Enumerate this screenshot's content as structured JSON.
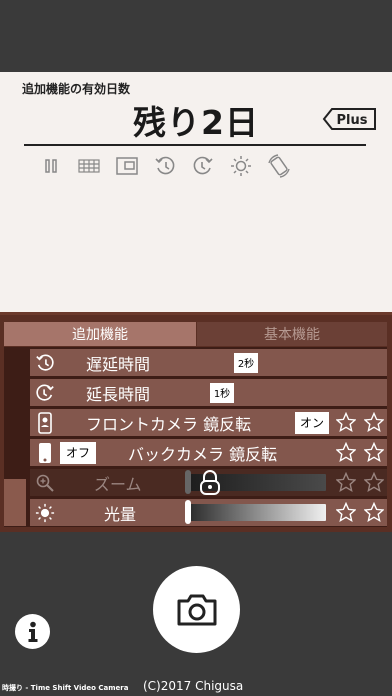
{
  "card": {
    "caption": "追加機能の有効日数",
    "days_left": "残り2日",
    "plus_badge": "Plus",
    "icons": [
      "pause-icon",
      "grid-icon",
      "picture-in-picture-icon",
      "delay-timer-icon",
      "extend-timer-icon",
      "brightness-icon",
      "rotate-icon"
    ]
  },
  "tabs": {
    "active": "追加機能",
    "inactive": "基本機能"
  },
  "rows": {
    "delay": {
      "label": "遅延時間",
      "value": "2秒",
      "icon": "delay-timer-icon"
    },
    "extend": {
      "label": "延長時間",
      "value": "1秒",
      "icon": "extend-timer-icon"
    },
    "front_mirror": {
      "label": "フロントカメラ 鏡反転",
      "value": "オン",
      "icon": "front-camera-icon"
    },
    "back_mirror": {
      "label": "バックカメラ 鏡反転",
      "value": "オフ",
      "icon": "back-camera-icon"
    },
    "zoom": {
      "label": "ズーム",
      "icon": "zoom-icon",
      "locked": true
    },
    "light": {
      "label": "光量",
      "icon": "brightness-icon"
    }
  },
  "colors": {
    "panel": "#5a2f24",
    "row": "#83574d",
    "tab_active": "#a6756a",
    "card_bg": "#f5f1ee"
  },
  "footer": {
    "app_name": "時撮り - Time Shift Video Camera",
    "copyright": "(C)2017 Chigusa"
  }
}
